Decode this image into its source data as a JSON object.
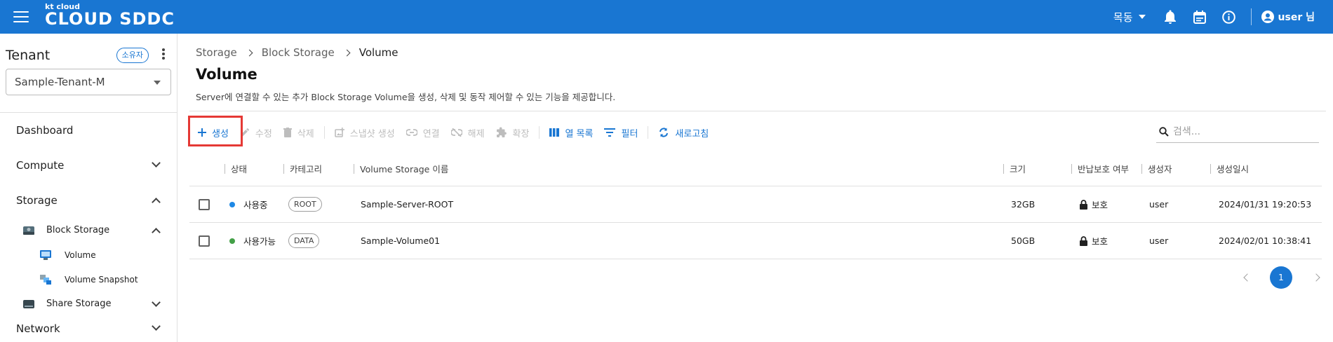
{
  "header": {
    "logo_small": "kt cloud",
    "logo_big": "CLOUD SDDC",
    "region": "목동",
    "user_label": "user 님"
  },
  "sidebar": {
    "tenant_title": "Tenant",
    "owner_chip": "소유자",
    "tenant_selected": "Sample-Tenant-M",
    "items": [
      {
        "label": "Dashboard"
      },
      {
        "label": "Compute"
      },
      {
        "label": "Storage"
      },
      {
        "label": "Block Storage"
      },
      {
        "label": "Volume"
      },
      {
        "label": "Volume Snapshot"
      },
      {
        "label": "Share Storage"
      },
      {
        "label": "Network"
      }
    ]
  },
  "breadcrumb": [
    "Storage",
    "Block Storage",
    "Volume"
  ],
  "page": {
    "title": "Volume",
    "description": "Server에 연결할 수 있는 추가 Block Storage Volume을 생성, 삭제 및 동작 제어할 수 있는 기능을 제공합니다."
  },
  "toolbar": {
    "create": "생성",
    "edit": "수정",
    "delete": "삭제",
    "snapshot": "스냅샷 생성",
    "attach": "연결",
    "detach": "해제",
    "extend": "확장",
    "columns": "열 목록",
    "filter": "필터",
    "refresh": "새로고침"
  },
  "search": {
    "placeholder": "검색..."
  },
  "table": {
    "headers": [
      "상태",
      "카테고리",
      "Volume Storage 이름",
      "크기",
      "반납보호 여부",
      "생성자",
      "생성일시"
    ],
    "rows": [
      {
        "status": "사용중",
        "status_color": "#1e88e5",
        "category": "ROOT",
        "name": "Sample-Server-ROOT",
        "size": "32GB",
        "protect": "보호",
        "creator": "user",
        "created": "2024/01/31 19:20:53"
      },
      {
        "status": "사용가능",
        "status_color": "#43a047",
        "category": "DATA",
        "name": "Sample-Volume01",
        "size": "50GB",
        "protect": "보호",
        "creator": "user",
        "created": "2024/02/01 10:38:41"
      }
    ]
  },
  "pagination": {
    "current": "1"
  },
  "colors": {
    "primary": "#1976d2",
    "highlight": "#e53935"
  }
}
